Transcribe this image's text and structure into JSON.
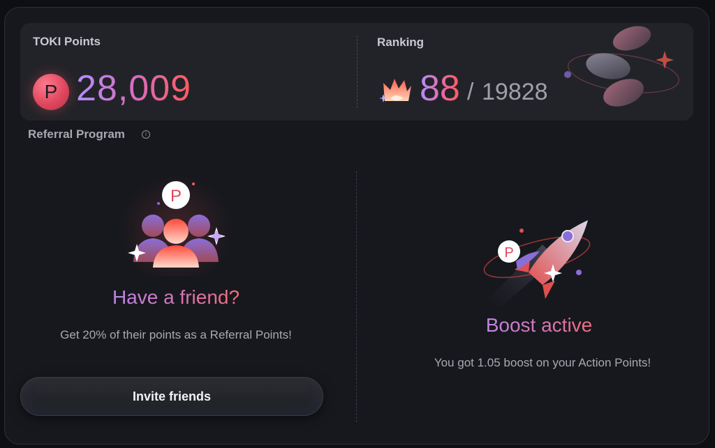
{
  "toki_points": {
    "label": "TOKI Points",
    "coin_letter": "P",
    "value": "28,009"
  },
  "ranking": {
    "label": "Ranking",
    "rank": "88",
    "slash": "/",
    "total": "19828"
  },
  "referral": {
    "title": "Referral Program",
    "info_glyph": "i",
    "friend_heading": "Have a friend?",
    "friend_subtext": "Get 20% of their points as a Referral Points!",
    "invite_button_label": "Invite friends",
    "friends_coin_letter": "P"
  },
  "boost": {
    "heading": "Boost active",
    "subtext": "You got 1.05 boost on your Action Points!",
    "coin_letter": "P"
  },
  "colors": {
    "accent_purple": "#b48cff",
    "accent_red": "#ff5a5a",
    "background": "#17181d"
  },
  "icons": [
    "p-coin-icon",
    "crown-icon",
    "coins-decoration-icon",
    "info-icon",
    "friends-group-icon",
    "rocket-icon"
  ]
}
